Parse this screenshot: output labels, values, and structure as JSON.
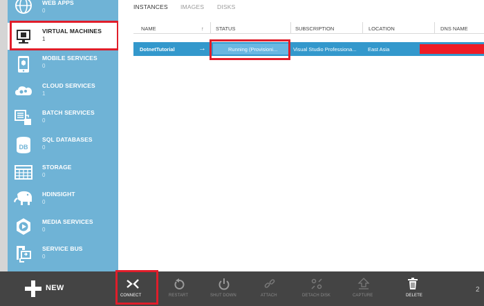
{
  "sidebar": {
    "items": [
      {
        "label": "WEB APPS",
        "count": "0",
        "icon": "web-apps-icon"
      },
      {
        "label": "VIRTUAL MACHINES",
        "count": "1",
        "icon": "virtual-machines-icon",
        "selected": true
      },
      {
        "label": "MOBILE SERVICES",
        "count": "0",
        "icon": "mobile-services-icon"
      },
      {
        "label": "CLOUD SERVICES",
        "count": "1",
        "icon": "cloud-services-icon"
      },
      {
        "label": "BATCH SERVICES",
        "count": "0",
        "icon": "batch-services-icon"
      },
      {
        "label": "SQL DATABASES",
        "count": "0",
        "icon": "sql-databases-icon",
        "icon_text": "DB"
      },
      {
        "label": "STORAGE",
        "count": "0",
        "icon": "storage-icon"
      },
      {
        "label": "HDINSIGHT",
        "count": "0",
        "icon": "hdinsight-icon"
      },
      {
        "label": "MEDIA SERVICES",
        "count": "0",
        "icon": "media-services-icon"
      },
      {
        "label": "SERVICE BUS",
        "count": "0",
        "icon": "service-bus-icon"
      }
    ]
  },
  "tabs": [
    "INSTANCES",
    "IMAGES",
    "DISKS"
  ],
  "table": {
    "headers": [
      "NAME",
      "STATUS",
      "SUBSCRIPTION",
      "LOCATION",
      "DNS NAME"
    ],
    "sort_indicator": "↑",
    "rows": [
      {
        "name": "DotnetTutorial",
        "arrow": "→",
        "status": "Running (Provisioni...",
        "subscription": "Visual Studio Professiona...",
        "location": "East Asia",
        "dns_name": ""
      }
    ]
  },
  "command_bar": {
    "new_label": "NEW",
    "commands": [
      {
        "label": "CONNECT",
        "icon": "connect-icon",
        "enabled": true
      },
      {
        "label": "RESTART",
        "icon": "restart-icon",
        "enabled": false
      },
      {
        "label": "SHUT DOWN",
        "icon": "shut-down-icon",
        "enabled": false
      },
      {
        "label": "ATTACH",
        "icon": "attach-icon",
        "enabled": false
      },
      {
        "label": "DETACH DISK",
        "icon": "detach-disk-icon",
        "enabled": false
      },
      {
        "label": "CAPTURE",
        "icon": "capture-icon",
        "enabled": false
      },
      {
        "label": "DELETE",
        "icon": "delete-icon",
        "enabled": true
      }
    ],
    "right_text": "2"
  },
  "colors": {
    "sidebar_bg": "#6fb3d6",
    "row_selected": "#3398cc",
    "command_bar_bg": "#444444",
    "highlight": "#e01d2a",
    "redaction": "#ee1c25"
  }
}
